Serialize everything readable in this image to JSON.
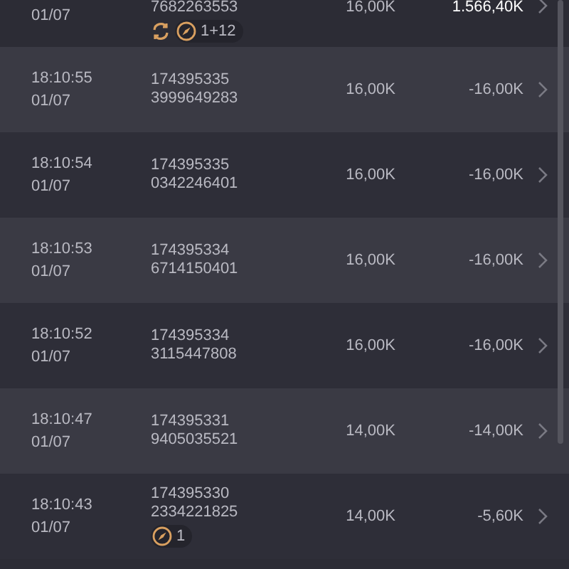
{
  "rows": [
    {
      "date": "01/07",
      "id_lines": [
        "7682263553"
      ],
      "badges": [
        {
          "kind": "refresh"
        },
        {
          "kind": "compass",
          "label": "1+12"
        }
      ],
      "size": "16,00K",
      "amount": "1.566,40K",
      "highlight": true
    },
    {
      "time": "18:10:55",
      "date": "01/07",
      "id_lines": [
        "174395335",
        "3999649283"
      ],
      "size": "16,00K",
      "amount": "-16,00K",
      "highlight": false
    },
    {
      "time": "18:10:54",
      "date": "01/07",
      "id_lines": [
        "174395335",
        "0342246401"
      ],
      "size": "16,00K",
      "amount": "-16,00K",
      "highlight": false
    },
    {
      "time": "18:10:53",
      "date": "01/07",
      "id_lines": [
        "174395334",
        "6714150401"
      ],
      "size": "16,00K",
      "amount": "-16,00K",
      "highlight": false
    },
    {
      "time": "18:10:52",
      "date": "01/07",
      "id_lines": [
        "174395334",
        "3115447808"
      ],
      "size": "16,00K",
      "amount": "-16,00K",
      "highlight": false
    },
    {
      "time": "18:10:47",
      "date": "01/07",
      "id_lines": [
        "174395331",
        "9405035521"
      ],
      "size": "14,00K",
      "amount": "-14,00K",
      "highlight": false
    },
    {
      "time": "18:10:43",
      "date": "01/07",
      "id_lines": [
        "174395330",
        "2334221825"
      ],
      "badges": [
        {
          "kind": "compass",
          "label": "1"
        }
      ],
      "size": "14,00K",
      "amount": "-5,60K",
      "highlight": false
    }
  ]
}
